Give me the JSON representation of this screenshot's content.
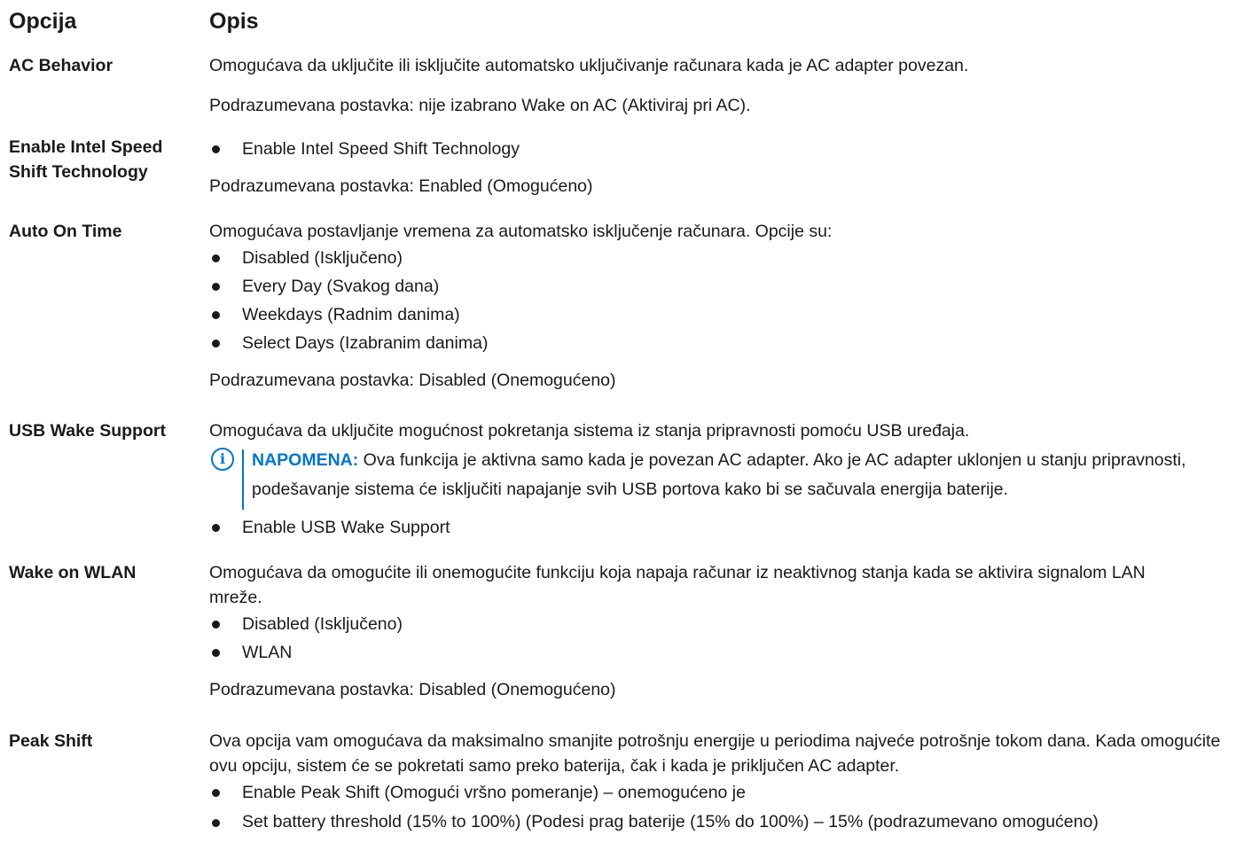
{
  "header": {
    "option": "Opcija",
    "description": "Opis"
  },
  "rows": [
    {
      "option": "AC Behavior",
      "desc": [
        "Omogućava da uključite ili isključite automatsko uključivanje računara kada je AC adapter povezan.",
        "Podrazumevana postavka: nije izabrano Wake on AC (Aktiviraj pri AC)."
      ]
    },
    {
      "option": "Enable Intel Speed Shift Technology",
      "bullets": [
        "Enable Intel Speed Shift Technology"
      ],
      "default": "Podrazumevana postavka: Enabled (Omogućeno)"
    },
    {
      "option": "Auto On Time",
      "intro": "Omogućava postavljanje vremena za automatsko isključenje računara. Opcije su:",
      "bullets": [
        "Disabled (Isključeno)",
        "Every Day (Svakog dana)",
        "Weekdays (Radnim danima)",
        "Select Days (Izabranim danima)"
      ],
      "default": "Podrazumevana postavka: Disabled (Onemogućeno)"
    },
    {
      "option": "USB Wake Support",
      "intro": "Omogućava da uključite mogućnost pokretanja sistema iz stanja pripravnosti pomoću USB uređaja.",
      "note_label": "NAPOMENA:",
      "note_text": " Ova funkcija je aktivna samo kada je povezan AC adapter. Ako je AC adapter uklonjen u stanju pripravnosti, podešavanje sistema će isključiti napajanje svih USB portova kako bi se sačuvala energija baterije.",
      "bullets": [
        "Enable USB Wake Support"
      ]
    },
    {
      "option": "Wake on WLAN",
      "intro": "Omogućava da omogućite ili onemogućite funkciju koja napaja računar iz neaktivnog stanja kada se aktivira signalom LAN mreže.",
      "bullets": [
        "Disabled (Isključeno)",
        "WLAN"
      ],
      "default": "Podrazumevana postavka: Disabled (Onemogućeno)"
    },
    {
      "option": "Peak Shift",
      "intro": "Ova opcija vam omogućava da maksimalno smanjite potrošnju energije u periodima najveće potrošnje tokom dana. Kada omogućite ovu opciju, sistem će se pokretati samo preko baterija, čak i kada je priključen AC adapter.",
      "bullets": [
        "Enable Peak Shift (Omogući vršno pomeranje) – onemogućeno je",
        "Set battery threshold (15% to 100%) (Podesi prag baterije (15% do 100%) – 15% (podrazumevano omogućeno)"
      ]
    }
  ]
}
